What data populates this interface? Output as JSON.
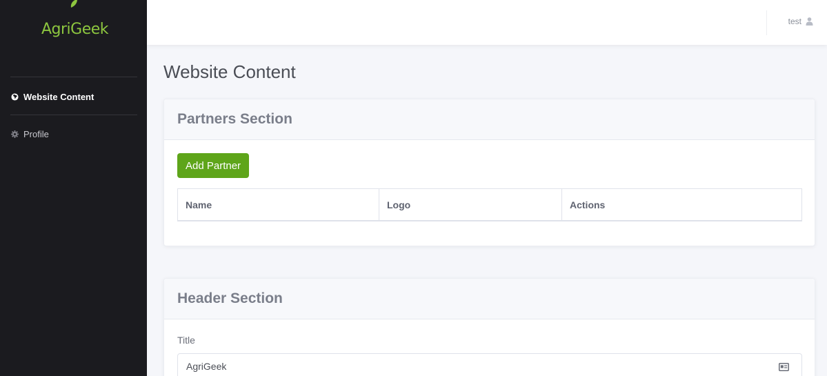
{
  "brand": {
    "name": "AgriGeek",
    "color": "#8dc63f"
  },
  "sidebar": {
    "items": [
      {
        "label": "Website Content",
        "icon": "globe-icon",
        "active": true
      },
      {
        "label": "Profile",
        "icon": "gear-icon",
        "active": false
      }
    ]
  },
  "topbar": {
    "user": "test",
    "user_icon": "user-icon"
  },
  "main": {
    "title": "Website Content",
    "partners": {
      "heading": "Partners Section",
      "add_button": "Add Partner",
      "columns": [
        "Name",
        "Logo",
        "Actions"
      ]
    },
    "header_section": {
      "heading": "Header Section",
      "title_label": "Title",
      "title_value": "AgriGeek",
      "field_icon": "id-card-icon"
    }
  },
  "colors": {
    "sidebar_bg": "#1b1b1f",
    "accent_green": "#5ea51a",
    "page_bg": "#f5f6fa"
  }
}
